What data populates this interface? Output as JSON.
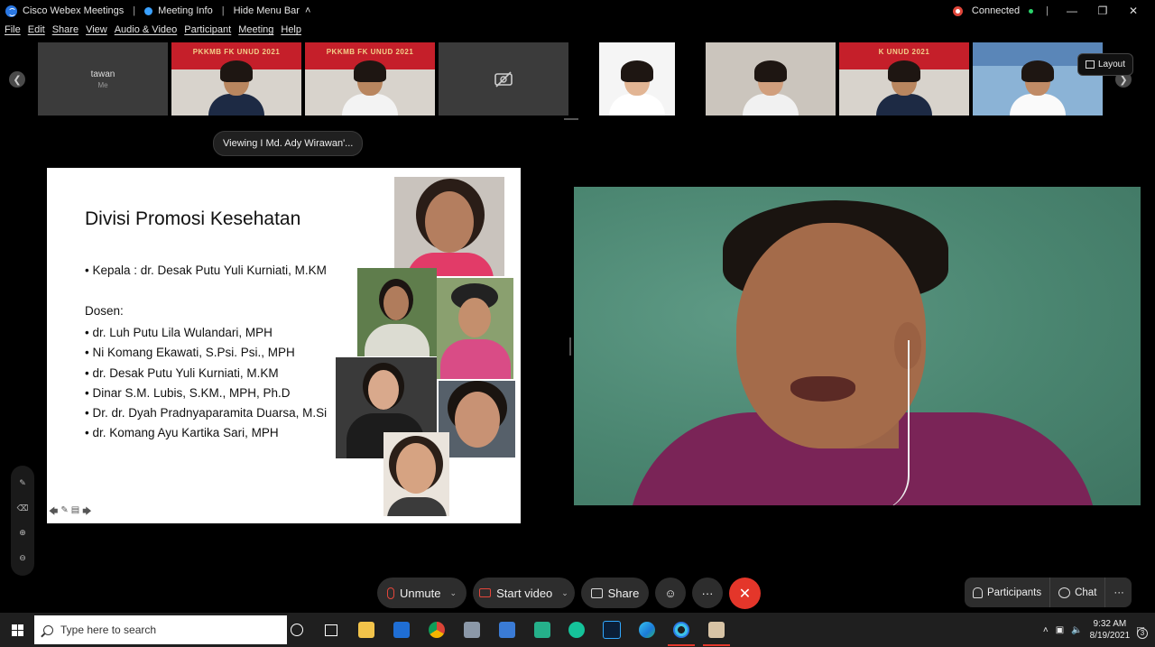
{
  "titlebar": {
    "app_title": "Cisco Webex Meetings",
    "meeting_info": "Meeting Info",
    "hide_menu": "Hide Menu Bar",
    "status": "Connected"
  },
  "menu": [
    "File",
    "Edit",
    "Share",
    "View",
    "Audio & Video",
    "Participant",
    "Meeting",
    "Help"
  ],
  "strip": {
    "self_name": "tawan",
    "self_sub": "Me",
    "banner_text": "PKKMB FK UNUD 2021",
    "banner_text_2": "UNUD 2021",
    "banner_text_3": "K UNUD 2021",
    "layout_label": "Layout"
  },
  "viewing_label": "Viewing I Md. Ady Wirawan'...",
  "slide": {
    "title": "Divisi Promosi Kesehatan",
    "kepala": "• Kepala : dr. Desak Putu Yuli Kurniati, M.KM",
    "dosen_heading": "Dosen:",
    "lecturers": [
      "dr. Luh Putu Lila Wulandari, MPH",
      "Ni Komang Ekawati, S.Psi. Psi., MPH",
      "dr. Desak Putu Yuli Kurniati, M.KM",
      "Dinar S.M. Lubis, S.KM., MPH, Ph.D",
      "Dr. dr. Dyah Pradnyaparamita Duarsa, M.Si",
      "dr. Komang Ayu Kartika Sari, MPH"
    ]
  },
  "controls": {
    "unmute": "Unmute",
    "start_video": "Start video",
    "share": "Share",
    "participants": "Participants",
    "chat": "Chat"
  },
  "taskbar": {
    "search_placeholder": "Type here to search",
    "time": "9:32 AM",
    "date": "8/19/2021",
    "notif_count": "3"
  },
  "colors": {
    "end_call": "#e4362a",
    "muted_red": "#e4463a",
    "connected_green": "#2bd36b"
  }
}
